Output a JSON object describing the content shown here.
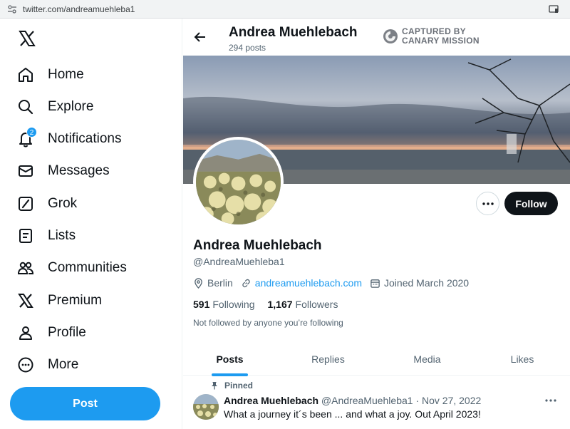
{
  "browser": {
    "url": "twitter.com/andreamuehleba1"
  },
  "nav": {
    "items": [
      {
        "label": "Home",
        "icon": "home-icon"
      },
      {
        "label": "Explore",
        "icon": "search-icon"
      },
      {
        "label": "Notifications",
        "icon": "bell-icon",
        "badge": "2"
      },
      {
        "label": "Messages",
        "icon": "envelope-icon"
      },
      {
        "label": "Grok",
        "icon": "grok-icon"
      },
      {
        "label": "Lists",
        "icon": "list-icon"
      },
      {
        "label": "Communities",
        "icon": "people-icon"
      },
      {
        "label": "Premium",
        "icon": "x-logo-icon"
      },
      {
        "label": "Profile",
        "icon": "person-icon"
      },
      {
        "label": "More",
        "icon": "more-circle-icon"
      }
    ],
    "post_label": "Post"
  },
  "header": {
    "name": "Andrea Muehlebach",
    "posts_count": "294 posts",
    "capture_line1": "CAPTURED BY",
    "capture_line2": "CANARY MISSION"
  },
  "profile": {
    "name": "Andrea Muehlebach",
    "handle": "@AndreaMuehleba1",
    "location": "Berlin",
    "website": "andreamuehlebach.com",
    "joined": "Joined March 2020",
    "following_count": "591",
    "following_label": "Following",
    "followers_count": "1,167",
    "followers_label": "Followers",
    "not_followed": "Not followed by anyone you’re following",
    "follow_label": "Follow"
  },
  "tabs": [
    "Posts",
    "Replies",
    "Media",
    "Likes"
  ],
  "pinned": {
    "label": "Pinned",
    "author": "Andrea Muehlebach",
    "handle_date": "@AndreaMuehleba1 · Nov 27, 2022",
    "text": "What a journey it´s been ... and what a joy. Out April 2023!"
  },
  "colors": {
    "accent": "#1d9bf0",
    "text": "#0f1419",
    "muted": "#536471"
  }
}
